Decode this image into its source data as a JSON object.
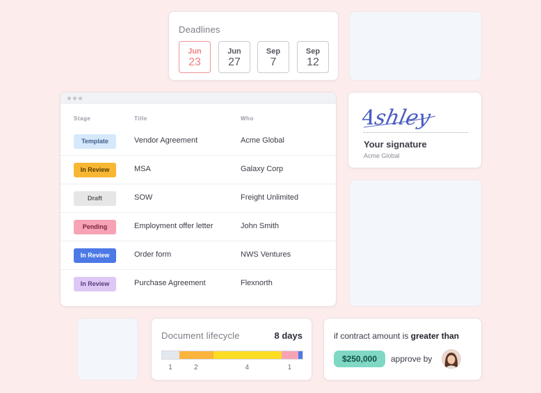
{
  "deadlines": {
    "title": "Deadlines",
    "dates": [
      {
        "month": "Jun",
        "day": "23"
      },
      {
        "month": "Jun",
        "day": "27"
      },
      {
        "month": "Sep",
        "day": "7"
      },
      {
        "month": "Sep",
        "day": "12"
      }
    ]
  },
  "table": {
    "headers": {
      "stage": "Stage",
      "title": "Title",
      "who": "Who"
    },
    "rows": [
      {
        "stage": "Template",
        "title": "Vendor Agreement",
        "who": "Acme Global",
        "bg": "#d5e9fb",
        "fg": "#3f5e88"
      },
      {
        "stage": "In Review",
        "title": "MSA",
        "who": "Galaxy Corp",
        "bg": "#f8b733",
        "fg": "#5b3c04"
      },
      {
        "stage": "Draft",
        "title": "SOW",
        "who": "Freight Unlimited",
        "bg": "#e6e6e6",
        "fg": "#5a5a62"
      },
      {
        "stage": "Pending",
        "title": "Employment offer letter",
        "who": "John Smith",
        "bg": "#f7a3b6",
        "fg": "#7c2339"
      },
      {
        "stage": "In Review",
        "title": "Order form",
        "who": "NWS Ventures",
        "bg": "#4c79e6",
        "fg": "#ffffff"
      },
      {
        "stage": "In Review",
        "title": "Purchase Agreement",
        "who": "Flexnorth",
        "bg": "#ddc8f5",
        "fg": "#5a3b7d"
      }
    ]
  },
  "signature": {
    "name": "Ashley",
    "label": "Your signature",
    "company": "Acme Global"
  },
  "lifecycle": {
    "title": "Document lifecycle",
    "days": "8 days",
    "segments": [
      {
        "value": 1,
        "label": "1",
        "color": "#e3e8ef"
      },
      {
        "value": 2,
        "label": "2",
        "color": "#fbb43c"
      },
      {
        "value": 4,
        "label": "4",
        "color": "#fddc24"
      },
      {
        "value": 1,
        "label": "1",
        "color": "#f7a3b6"
      }
    ],
    "end_color": "#4c79e6"
  },
  "contract": {
    "text_prefix": "if contract amount is",
    "text_bold": "greater than",
    "amount": "$250,000",
    "approve": "approve by"
  }
}
